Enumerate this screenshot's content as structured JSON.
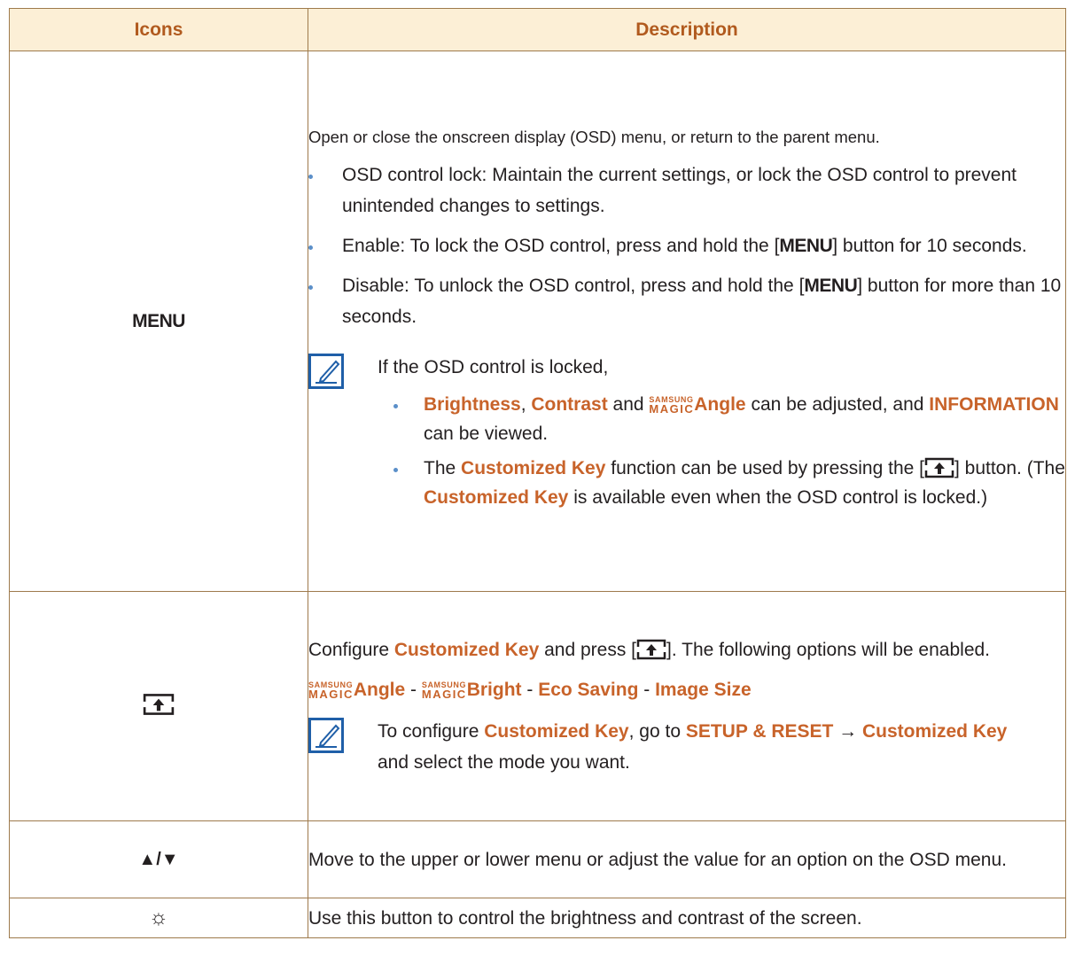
{
  "header": {
    "icons": "Icons",
    "description": "Description"
  },
  "row_menu": {
    "icon_label": "MENU",
    "intro": "Open or close the onscreen display (OSD) menu, or return to the parent menu.",
    "bullet1": "OSD control lock: Maintain the current settings, or lock the OSD control to prevent unintended changes to settings.",
    "bullet2_a": "Enable: To lock the OSD control, press and hold the [",
    "bullet2_key": "MENU",
    "bullet2_b": "] button for 10 seconds.",
    "bullet3_a": "Disable: To unlock the OSD control, press and hold the [",
    "bullet3_key": "MENU",
    "bullet3_b": "] button for more than 10 seconds.",
    "note_intro": "If the OSD control is locked,",
    "sub1": {
      "brightness": "Brightness",
      "comma": ", ",
      "contrast": "Contrast",
      "and": " and ",
      "samsung": "SAMSUNG",
      "magic": "MAGIC",
      "angle": "Angle",
      "mid": " can be adjusted, and ",
      "information": "INFORMATION",
      "end": " can be viewed."
    },
    "sub2": {
      "a": "The ",
      "key1": "Customized Key",
      "b": " function can be used by pressing the [",
      "c": "] button. (The ",
      "key2": "Customized Key",
      "d": " is available even when the OSD control is locked.)"
    }
  },
  "row_custom": {
    "line1_a": "Configure ",
    "line1_key": "Customized Key",
    "line1_b": " and press [",
    "line1_c": "]. The following options will be enabled.",
    "options": {
      "samsung": "SAMSUNG",
      "magic": "MAGIC",
      "angle": "Angle",
      "sep": " - ",
      "bright": "Bright",
      "eco": "Eco Saving",
      "image": "Image Size"
    },
    "note": {
      "a": "To configure ",
      "key": "Customized Key",
      "b": ", go to ",
      "setup": "SETUP & RESET",
      "arrow": "  → ",
      "key2": "Customized Key",
      "c": " and select the mode you want."
    }
  },
  "row_updown": {
    "icon_label": "▲/▼",
    "text": "Move to the upper or lower menu or adjust the value for an option on the OSD menu."
  },
  "row_sun": {
    "icon_label": "☼",
    "text": "Use this button to control the brightness and contrast of the screen."
  },
  "colors": {
    "header_bg": "#fcefd6",
    "header_text": "#b15a1e",
    "highlight": "#c8632a",
    "bullet": "#5b8fc9",
    "border": "#9e7a4c"
  },
  "icons": [
    "note-pencil-icon",
    "customized-key-icon",
    "sun-icon"
  ]
}
